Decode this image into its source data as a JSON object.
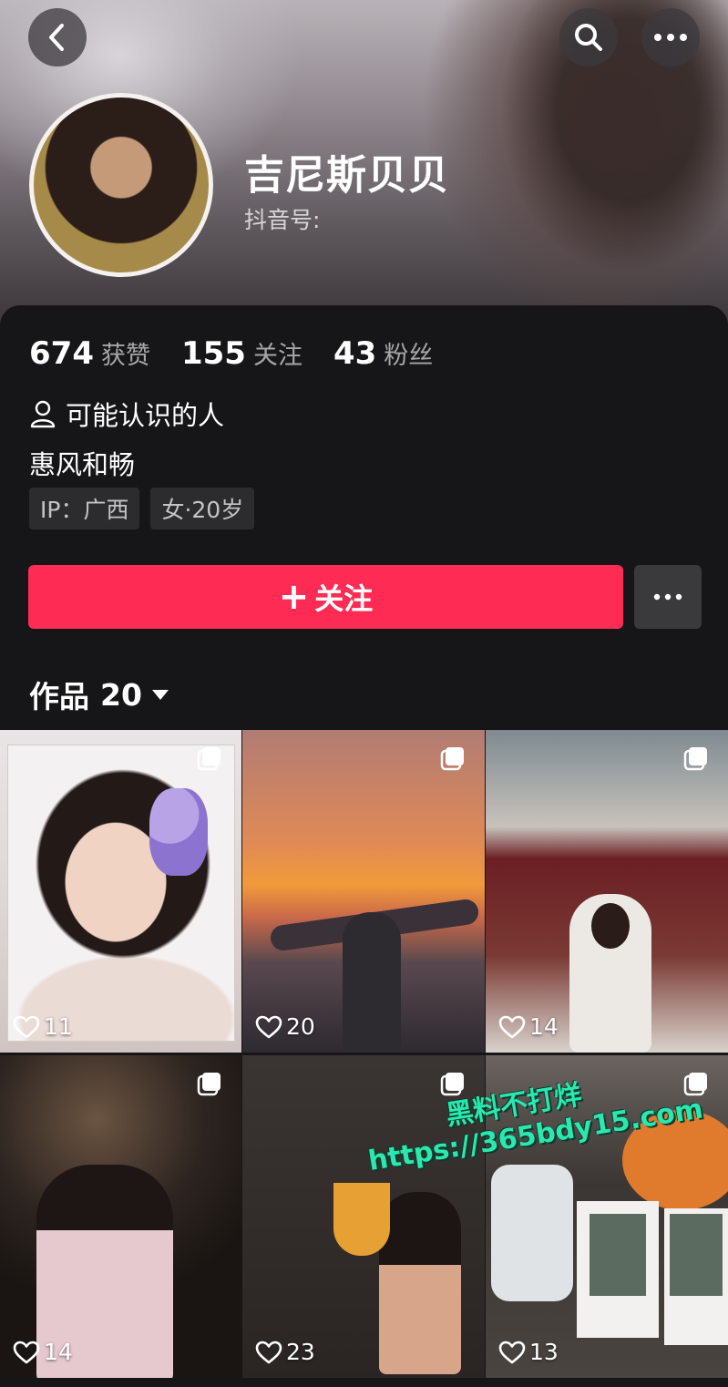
{
  "header": {
    "nickname": "吉尼斯贝贝",
    "douyin_id_label": "抖音号:"
  },
  "stats": [
    {
      "value": "674",
      "label": "获赞"
    },
    {
      "value": "155",
      "label": "关注"
    },
    {
      "value": "43",
      "label": "粉丝"
    }
  ],
  "maybe_know": "可能认识的人",
  "bio": "惠风和畅",
  "tags": [
    "IP：广西",
    "女·20岁"
  ],
  "follow_button": {
    "icon": "+",
    "label": "关注"
  },
  "works_tab": {
    "label": "作品",
    "count": "20"
  },
  "grid": [
    {
      "likes": "11"
    },
    {
      "likes": "20"
    },
    {
      "likes": "14"
    },
    {
      "likes": "14"
    },
    {
      "likes": "23"
    },
    {
      "likes": "13"
    }
  ],
  "watermark": {
    "line1": "黑料不打烊",
    "line2": "https://365bdy15.com"
  },
  "colors": {
    "accent": "#fe2c55",
    "background": "#161618",
    "watermark": "#2ae8b0"
  }
}
